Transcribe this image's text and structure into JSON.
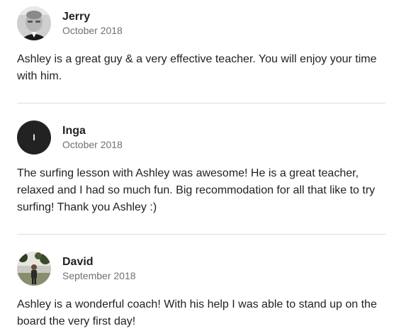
{
  "reviews": [
    {
      "name": "Jerry",
      "date": "October 2018",
      "avatar": "photo-avatar",
      "text": "Ashley is a great guy & a very effective teacher. You will enjoy your time with him."
    },
    {
      "name": "Inga",
      "date": "October 2018",
      "avatar_initial": "I",
      "text": "The surfing lesson with Ashley was awesome! He is a great teacher, relaxed and I had so much fun. Big recommodation for all that like to try surfing! Thank you Ashley :)"
    },
    {
      "name": "David",
      "date": "September 2018",
      "avatar": "photo-avatar",
      "text": "Ashley is a wonderful coach! With his help I was able to stand up on the board the very first day!"
    }
  ]
}
